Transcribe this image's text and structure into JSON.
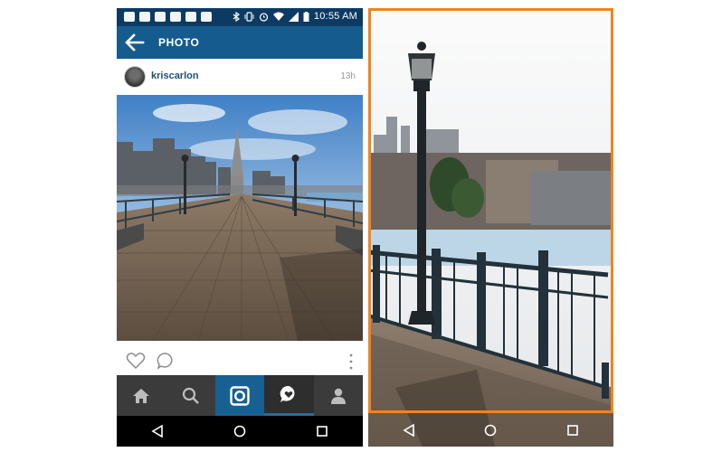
{
  "status_bar": {
    "time": "10:55 AM"
  },
  "app_bar": {
    "title": "PHOTO",
    "back_icon": "arrow-back-icon"
  },
  "post": {
    "username": "kriscarlon",
    "time_ago": "13h"
  },
  "actions": {
    "like_icon": "heart-icon",
    "comment_icon": "comment-icon",
    "more_icon": "more-vertical-icon"
  },
  "tabs": [
    {
      "icon": "home-icon"
    },
    {
      "icon": "search-icon"
    },
    {
      "icon": "camera-icon"
    },
    {
      "icon": "activity-icon"
    },
    {
      "icon": "profile-icon"
    }
  ],
  "nav_buttons": [
    {
      "icon": "back-triangle-icon"
    },
    {
      "icon": "home-circle-icon"
    },
    {
      "icon": "recents-square-icon"
    }
  ],
  "colors": {
    "app_bar": "#165b8e",
    "status_bar": "#0d3a62",
    "accent_active_tab": "#176092",
    "highlight_frame": "#f08420"
  }
}
